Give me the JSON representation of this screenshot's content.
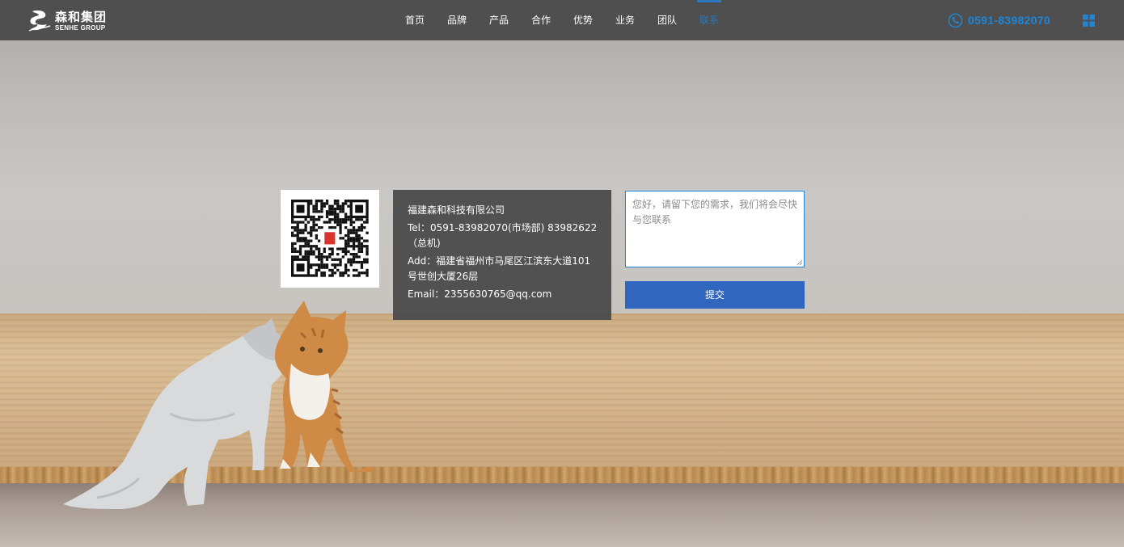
{
  "brand": {
    "name_cn": "森和集团",
    "name_en": "SENHE GROUP",
    "logo_icon": "senhe-logo-icon"
  },
  "nav": {
    "items": [
      {
        "label": "首页"
      },
      {
        "label": "品牌"
      },
      {
        "label": "产品"
      },
      {
        "label": "合作"
      },
      {
        "label": "优势"
      },
      {
        "label": "业务"
      },
      {
        "label": "团队"
      },
      {
        "label": "联系"
      }
    ],
    "active_index": 7
  },
  "header": {
    "phone": "0591-83982070",
    "phone_icon": "phone-icon",
    "menu_icon": "grid-menu-icon"
  },
  "contact": {
    "company": "福建森和科技有限公司",
    "tel": "Tel：0591-83982070(市场部) 83982622（总机)",
    "address": "Add：福建省福州市马尾区江滨东大道101号世创大厦26层",
    "email": "Email：2355630765@qq.com",
    "qr_icon": "wechat-qr-code"
  },
  "message_form": {
    "placeholder": "您好，请留下您的需求，我们将会尽快与您联系",
    "value": "",
    "submit_label": "提交"
  },
  "colors": {
    "header_bg": "#4f4f4f",
    "accent": "#2a78bd",
    "phone": "#1e86d6",
    "submit_bg": "#3066be"
  }
}
